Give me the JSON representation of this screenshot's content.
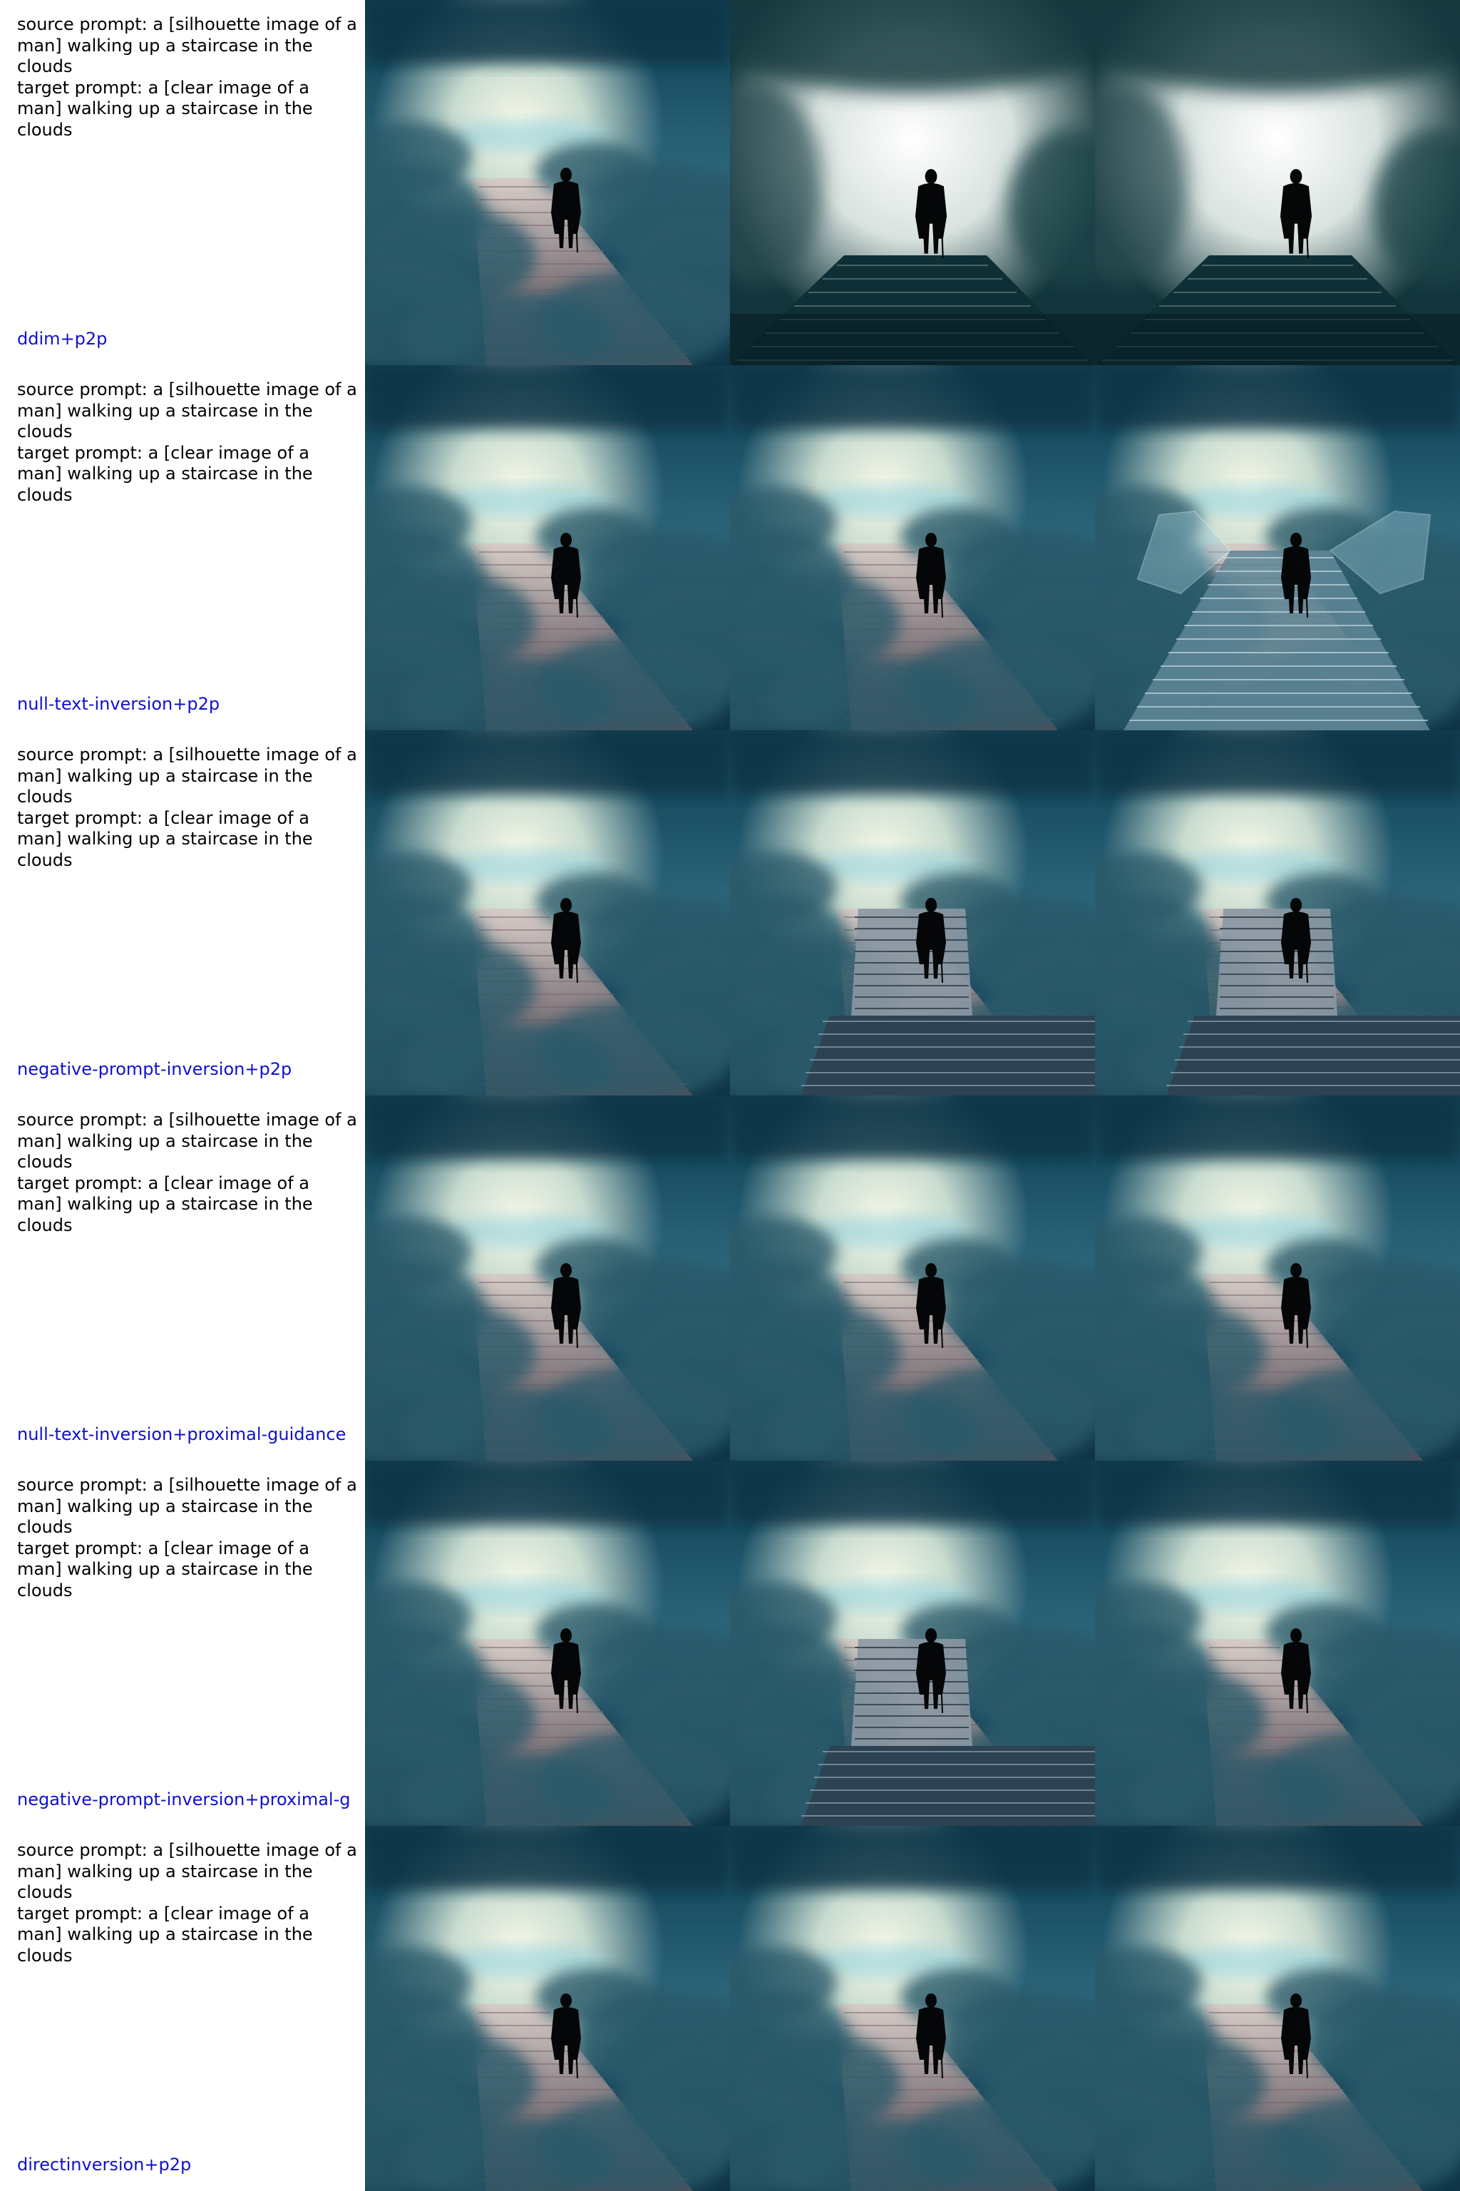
{
  "prompt_text": "source prompt: a [silhouette image of a man] walking up a staircase in the clouds\ntarget prompt: a [clear image of a man] walking up a staircase in the clouds",
  "rows": [
    {
      "method": "ddim+p2p",
      "variants": [
        "cloud",
        "white-fog",
        "white-fog"
      ]
    },
    {
      "method": "null-text-inversion+p2p",
      "variants": [
        "cloud",
        "cloud",
        "glass-bridge"
      ]
    },
    {
      "method": "negative-prompt-inversion+p2p",
      "variants": [
        "cloud",
        "stone-steps",
        "stone-steps"
      ]
    },
    {
      "method": "null-text-inversion+proximal-guidance",
      "variants": [
        "cloud",
        "cloud",
        "cloud"
      ]
    },
    {
      "method": "negative-prompt-inversion+proximal-g",
      "variants": [
        "cloud",
        "stone-steps",
        "cloud"
      ]
    },
    {
      "method": "directinversion+p2p",
      "variants": [
        "cloud",
        "cloud",
        "cloud"
      ]
    }
  ],
  "colors": {
    "method_label": "#1010d0",
    "prompt_text": "#000000"
  }
}
